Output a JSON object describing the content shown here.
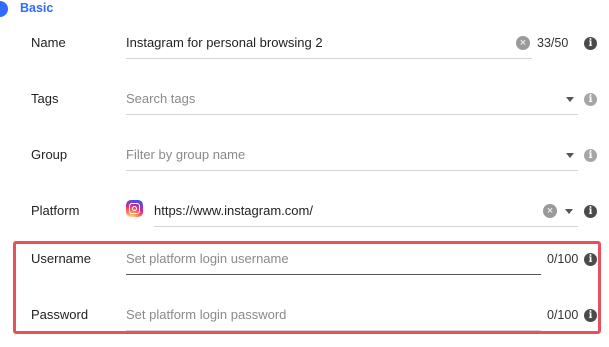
{
  "section": {
    "title": "Basic"
  },
  "name": {
    "label": "Name",
    "value": "Instagram for personal browsing 2",
    "counter": "33/50"
  },
  "tags": {
    "label": "Tags",
    "placeholder": "Search tags"
  },
  "group": {
    "label": "Group",
    "placeholder": "Filter by group name"
  },
  "platform": {
    "label": "Platform",
    "value": "https://www.instagram.com/"
  },
  "username": {
    "label": "Username",
    "placeholder": "Set platform login username",
    "counter": "0/100"
  },
  "password": {
    "label": "Password",
    "placeholder": "Set platform login password",
    "counter": "0/100"
  },
  "colors": {
    "accent": "#2f6bff",
    "highlight": "#e8505b"
  }
}
